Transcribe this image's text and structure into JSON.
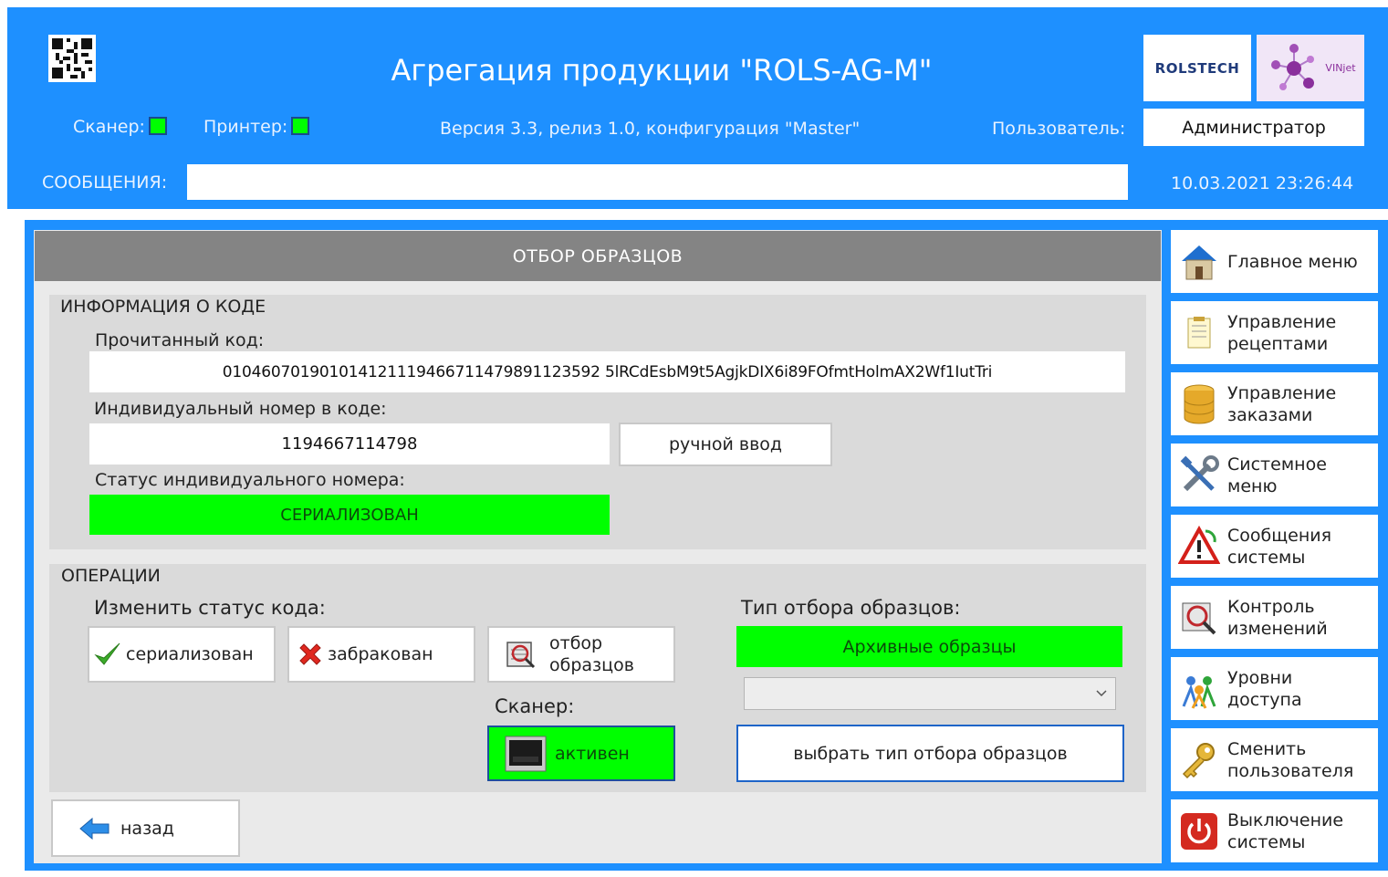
{
  "header": {
    "title": "Агрегация продукции \"ROLS-AG-M\"",
    "scanner_label": "Сканер:",
    "printer_label": "Принтер:",
    "version": "Версия 3.3, релиз 1.0, конфигурация \"Master\"",
    "user_label": "Пользователь:",
    "user_value": "Администратор",
    "messages_label": "СООБЩЕНИЯ:",
    "messages_value": "",
    "datetime": "10.03.2021 23:26:44",
    "logo_rolstech": "ROLSTECH",
    "logo_vinjet": "VINjet",
    "indicator_color": "#00ff00",
    "accent_color": "#1e90ff"
  },
  "main": {
    "title": "ОТБОР ОБРАЗЦОВ",
    "code_info": {
      "section_title": "ИНФОРМАЦИЯ О КОДЕ",
      "read_code_label": "Прочитанный код:",
      "read_code_value": "010460701901014121119466711479891123592 5lRCdEsbM9t5AgjkDIX6i89FOfmtHolmAX2Wf1IutTri",
      "serial_label": "Индивидуальный номер в коде:",
      "serial_value": "1194667114798",
      "manual_input_button": "ручной ввод",
      "status_label": "Статус индивидуального номера:",
      "status_value": "СЕРИАЛИЗОВАН"
    },
    "operations": {
      "section_title": "ОПЕРАЦИИ",
      "change_status_label": "Изменить статус кода:",
      "btn_serialized": "сериализован",
      "btn_rejected": "забракован",
      "btn_sampling": "отбор\nобразцов",
      "scanner_label": "Сканер:",
      "scanner_state": "активен",
      "sample_type_label": "Тип отбора образцов:",
      "sample_type_value": "Архивные образцы",
      "dropdown_value": "",
      "choose_type_button": "выбрать тип отбора образцов"
    },
    "back_button": "назад"
  },
  "side_menu": [
    {
      "label": "Главное меню",
      "icon": "home-icon"
    },
    {
      "label": "Управление\nрецептами",
      "icon": "recipe-icon"
    },
    {
      "label": "Управление\nзаказами",
      "icon": "database-icon"
    },
    {
      "label": "Системное\nменю",
      "icon": "tools-icon"
    },
    {
      "label": "Сообщения\nсистемы",
      "icon": "warning-icon"
    },
    {
      "label": "Контроль\nизменений",
      "icon": "audit-icon"
    },
    {
      "label": "Уровни\nдоступа",
      "icon": "users-icon"
    },
    {
      "label": "Сменить\nпользователя",
      "icon": "key-icon"
    },
    {
      "label": "Выключение\nсистемы",
      "icon": "power-icon"
    }
  ]
}
